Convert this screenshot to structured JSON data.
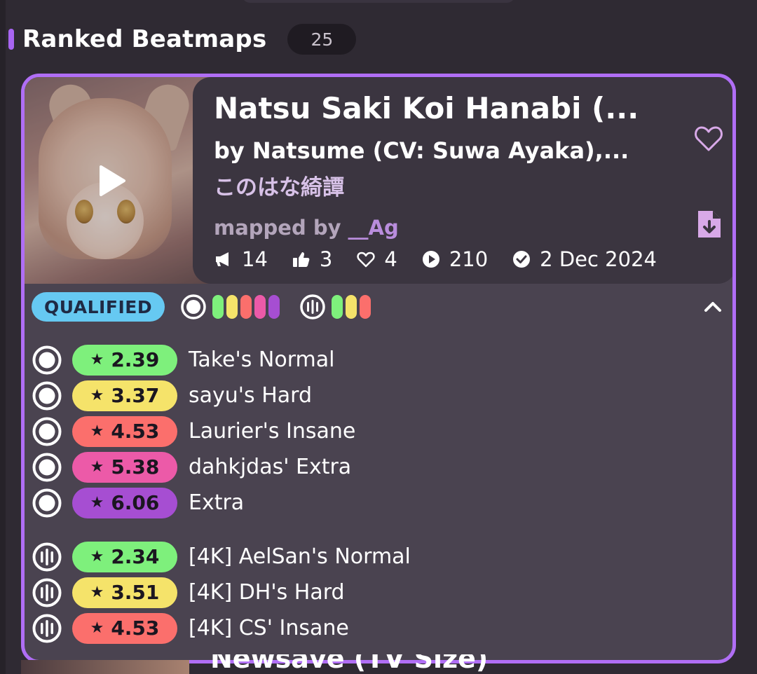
{
  "section": {
    "title": "Ranked Beatmaps",
    "count": "25"
  },
  "beatmap": {
    "title": "Natsu Saki Koi Hanabi (...",
    "artist": "by Natsume (CV: Suwa Ayaka),...",
    "source": "このはな綺譚",
    "mapped_by_label": "mapped by",
    "mapper": "__Ag",
    "stats": {
      "comments": "14",
      "likes": "3",
      "favourites": "4",
      "plays": "210",
      "date": "2 Dec 2024"
    },
    "status": "QUALIFIED",
    "mode_pips": {
      "osu": [
        "#7ef07c",
        "#f5e36a",
        "#fb6f6c",
        "#ec5aa8",
        "#a64ed2"
      ],
      "mania": [
        "#7ef07c",
        "#f5e36a",
        "#fb6f6c"
      ]
    },
    "difficulties": [
      {
        "mode": "osu",
        "stars": "2.39",
        "color": "#7ef07c",
        "name": "Take's Normal"
      },
      {
        "mode": "osu",
        "stars": "3.37",
        "color": "#f5e36a",
        "name": "sayu's Hard"
      },
      {
        "mode": "osu",
        "stars": "4.53",
        "color": "#fb6f6c",
        "name": "Laurier's Insane"
      },
      {
        "mode": "osu",
        "stars": "5.38",
        "color": "#ec5aa8",
        "name": "dahkjdas' Extra"
      },
      {
        "mode": "osu",
        "stars": "6.06",
        "color": "#a64ed2",
        "name": "Extra"
      },
      {
        "mode": "mania",
        "stars": "2.34",
        "color": "#7ef07c",
        "name": "[4K] AelSan's Normal"
      },
      {
        "mode": "mania",
        "stars": "3.51",
        "color": "#f5e36a",
        "name": "[4K] DH's Hard"
      },
      {
        "mode": "mania",
        "stars": "4.53",
        "color": "#fb6f6c",
        "name": "[4K] CS' Insane"
      }
    ]
  },
  "next_beatmap": {
    "title_peek": "Newsave (TV Size)"
  },
  "colors": {
    "accent": "#b06ef5",
    "status_bg": "#66c9f2"
  }
}
